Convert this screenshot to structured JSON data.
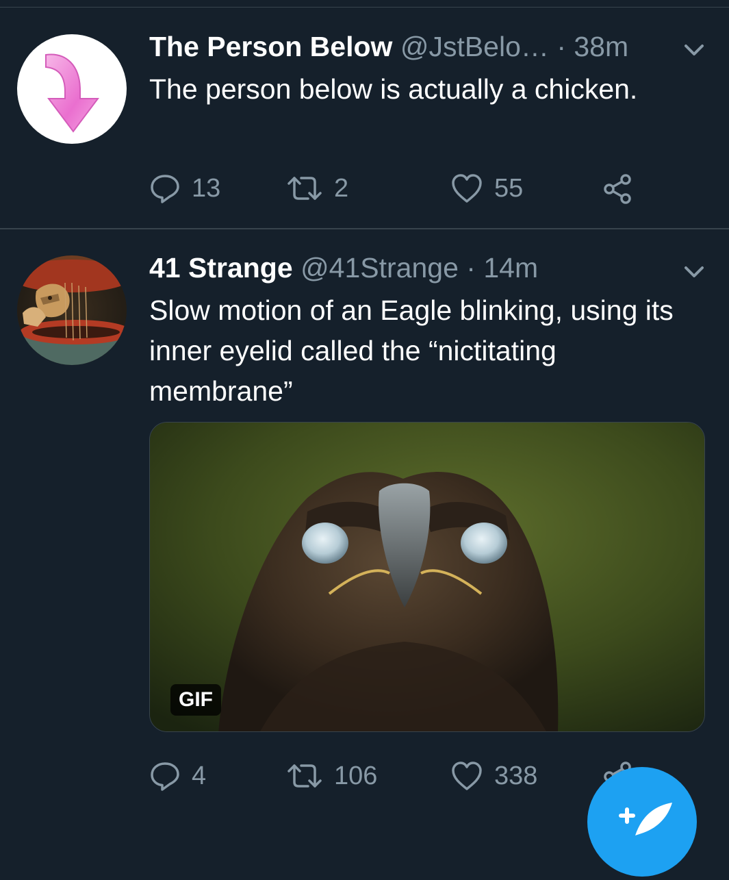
{
  "tweets": [
    {
      "display_name": "The Person Below",
      "handle": "@JstBelo…",
      "time": " · 38m",
      "text": "The person below is actually a chicken.",
      "replies": "13",
      "retweets": "2",
      "likes": "55",
      "avatar_icon": "pink-down-arrow-icon"
    },
    {
      "display_name": "41 Strange",
      "handle": "@41Strange",
      "time": " · 14m",
      "text": "Slow motion of an Eagle blinking, using its inner eyelid called the “nictitating membrane”",
      "replies": "4",
      "retweets": "106",
      "likes": "338",
      "media_badge": "GIF"
    }
  ],
  "colors": {
    "background": "#15202b",
    "divider": "#38444d",
    "muted_text": "#8899a6",
    "accent": "#1da1f2",
    "avatar_arrow": "#f08bd6"
  },
  "icons": [
    "chevron-down-icon",
    "reply-icon",
    "retweet-icon",
    "like-icon",
    "share-icon",
    "compose-icon"
  ]
}
